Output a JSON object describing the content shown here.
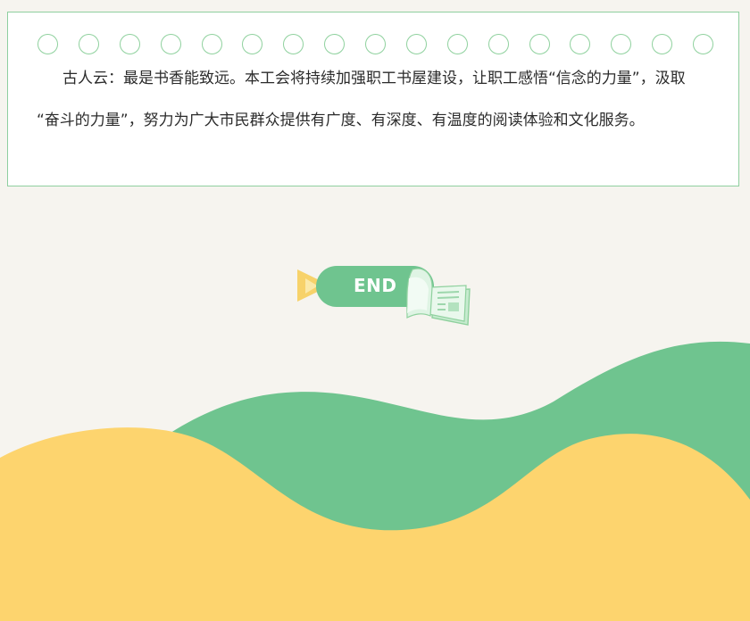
{
  "card": {
    "ring_count": 17,
    "ring_color": "#8fd19e",
    "paragraph_line_1": "古人云：最是书香能致远。本工会将持续加强职工书屋建设，让职工感悟“信念的力量”，汲取",
    "paragraph_line_2": "“奋斗的力量”，努力为广大市民群众提供有广度、有深度、有温度的阅读体验和文化服务。"
  },
  "end_badge": {
    "label": "END",
    "icon": "open-book-icon",
    "pill_color": "#6fc48f",
    "arrow_color": "#f7d26a"
  },
  "decoration": {
    "green_wave_color": "#6fc48f",
    "yellow_wave_color": "#fdd46e",
    "background_color": "#f6f4ef"
  }
}
